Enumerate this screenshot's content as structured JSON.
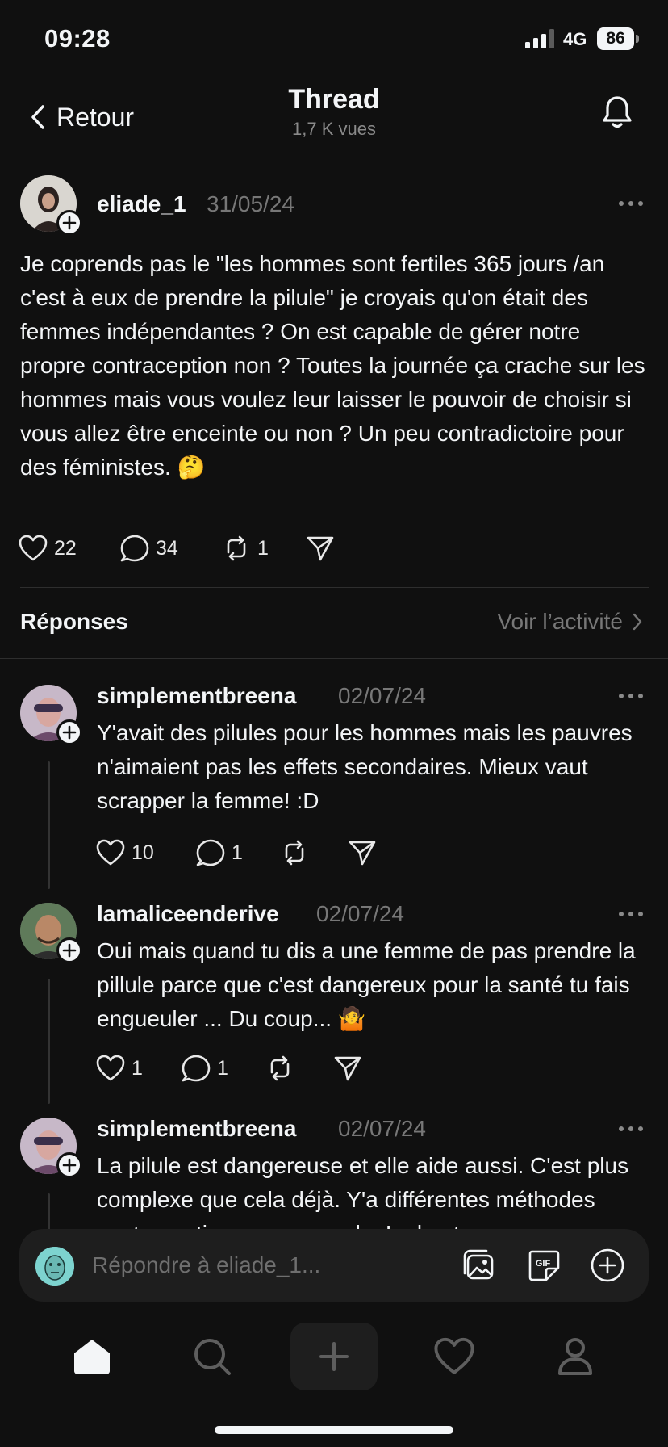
{
  "status": {
    "time": "09:28",
    "network": "4G",
    "battery": "86"
  },
  "header": {
    "back_label": "Retour",
    "title": "Thread",
    "views": "1,7 K vues"
  },
  "post": {
    "username": "eliade_1",
    "date": "31/05/24",
    "text": "Je coprends pas le \"les hommes sont fertiles 365 jours /an c'est à eux de prendre la pilule\" je croyais qu'on était des femmes indépendantes ? On est capable de gérer notre propre contraception non ? Toutes la journée ça crache sur les hommes mais vous voulez leur laisser le pouvoir de choisir si vous allez être enceinte ou non ? Un peu contradictoire pour des féministes. 🤔",
    "likes": "22",
    "comments": "34",
    "reposts": "1"
  },
  "replies_section": {
    "title": "Réponses",
    "activity_label": "Voir l’activité"
  },
  "replies": [
    {
      "username": "simplementbreena",
      "date": "02/07/24",
      "text": "Y'avait des pilules pour les hommes mais les pauvres n'aimaient pas les effets secondaires. Mieux vaut scrapper la femme! :D",
      "likes": "10",
      "comments": "1",
      "reposts": ""
    },
    {
      "username": "lamaliceenderive",
      "date": "02/07/24",
      "text": "Oui mais quand tu dis a une femme de pas prendre la pillule parce que c'est dangereux pour la santé tu fais engueuler ... Du coup... 🤷",
      "likes": "1",
      "comments": "1",
      "reposts": ""
    },
    {
      "username": "simplementbreena",
      "date": "02/07/24",
      "text": "La pilule est dangereuse et elle aide aussi. C'est plus complexe que cela déjà. Y'a différentes méthodes contraceptives par exemple. Le best"
    }
  ],
  "composer": {
    "placeholder": "Répondre à eliade_1..."
  },
  "icons": {
    "back": "chevron-left-icon",
    "bell": "bell-icon",
    "more": "more-icon",
    "like": "heart-icon",
    "comment": "comment-icon",
    "repost": "repost-icon",
    "share": "send-icon",
    "image": "image-icon",
    "gif": "gif-icon",
    "add": "plus-circle-icon",
    "home": "home-icon",
    "search": "search-icon",
    "create": "plus-icon",
    "activity": "heart-icon",
    "profile": "profile-icon"
  },
  "colors": {
    "background": "#101010",
    "text": "#f3f5f7",
    "muted": "#777777",
    "surface": "#1e1e1e"
  }
}
